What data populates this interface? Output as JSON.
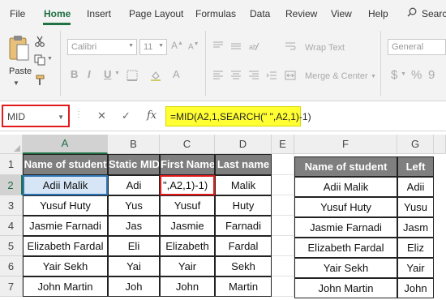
{
  "ribbon": {
    "tabs": [
      {
        "label": "File"
      },
      {
        "label": "Home"
      },
      {
        "label": "Insert"
      },
      {
        "label": "Page Layout"
      },
      {
        "label": "Formulas"
      },
      {
        "label": "Data"
      },
      {
        "label": "Review"
      },
      {
        "label": "View"
      },
      {
        "label": "Help"
      }
    ],
    "search_label": "Search",
    "paste_label": "Paste",
    "font_name": "Calibri",
    "font_size": "11",
    "bold_label": "B",
    "italic_label": "I",
    "underline_label": "U",
    "wrap_text_label": "Wrap Text",
    "merge_center_label": "Merge & Center",
    "number_format": "General",
    "currency_symbol": "$",
    "percent_symbol": "%",
    "comma_symbol": "9",
    "accent_color": "#217346"
  },
  "formula_bar": {
    "name_box": "MID",
    "cancel_symbol": "✕",
    "enter_symbol": "✓",
    "fx_label": "fx",
    "formula": "=MID(A2,1,SEARCH(\" \",A2,1)-1)"
  },
  "columns": [
    "A",
    "B",
    "C",
    "D",
    "E",
    "F",
    "G"
  ],
  "rows": [
    "1",
    "2",
    "3",
    "4",
    "5",
    "6",
    "7"
  ],
  "table1": {
    "headers": [
      "Name of student",
      "Static MID",
      "First Name",
      "Last name"
    ],
    "rows": [
      [
        "Adii Malik",
        "Adi",
        "\",A2,1)-1)",
        "Malik"
      ],
      [
        "Yusuf Huty",
        "Yus",
        "Yusuf",
        "Huty"
      ],
      [
        "Jasmie Farnadi",
        "Jas",
        "Jasmie",
        "Farnadi"
      ],
      [
        "Elizabeth Fardal",
        "Eli",
        "Elizabeth",
        "Fardal"
      ],
      [
        "Yair Sekh",
        "Yai",
        "Yair",
        "Sekh"
      ],
      [
        "John Martin",
        "Joh",
        "John",
        "Martin"
      ]
    ]
  },
  "table2": {
    "headers": [
      "Name of student",
      "Left"
    ],
    "rows": [
      [
        "Adii Malik",
        "Adii"
      ],
      [
        "Yusuf Huty",
        "Yusu"
      ],
      [
        "Jasmie Farnadi",
        "Jasm"
      ],
      [
        "Elizabeth Fardal",
        "Eliz"
      ],
      [
        "Yair Sekh",
        "Yair"
      ],
      [
        "John Martin",
        "John"
      ]
    ]
  }
}
